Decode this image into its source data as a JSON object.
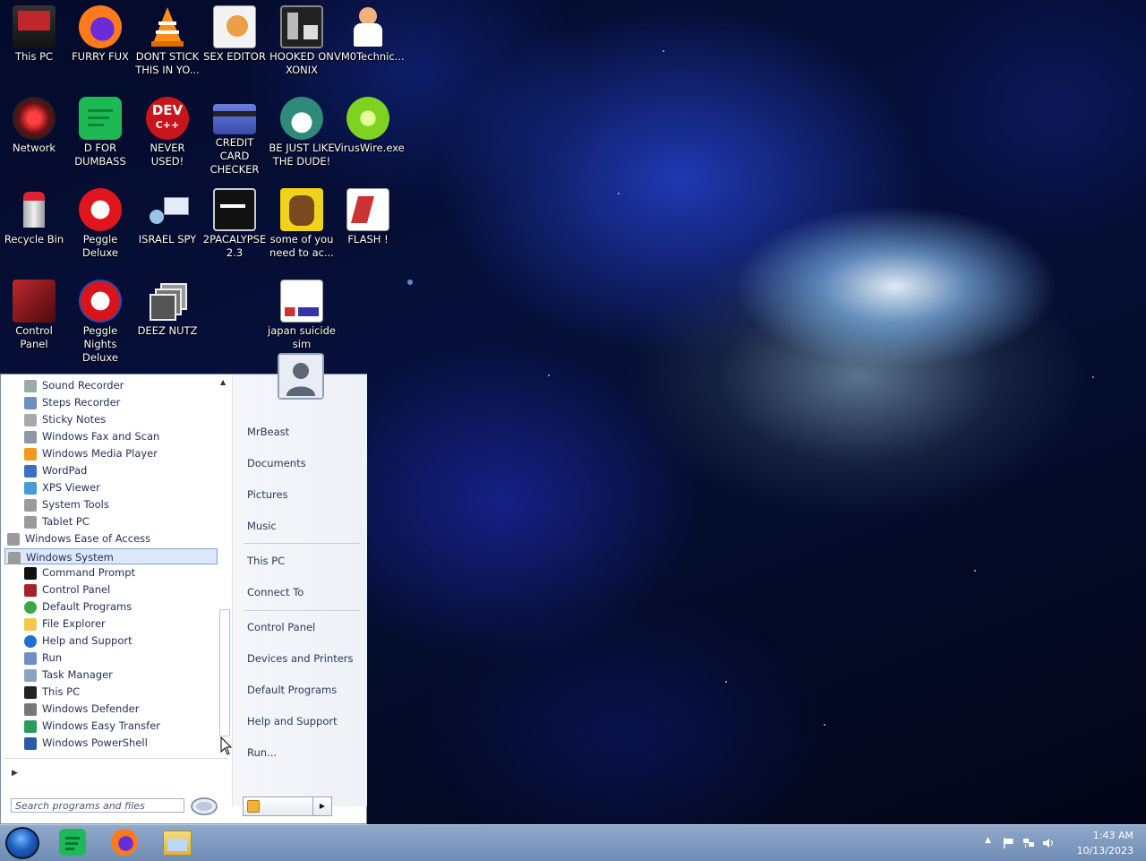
{
  "desktop": {
    "icons": [
      {
        "label": "This PC"
      },
      {
        "label": "FURRY FUX"
      },
      {
        "label": "DONT STICK THIS IN YO..."
      },
      {
        "label": "SEX EDITOR"
      },
      {
        "label": "HOOKED ON XONIX"
      },
      {
        "label": "VM0Technic..."
      },
      {
        "label": "Network"
      },
      {
        "label": "D FOR DUMBASS"
      },
      {
        "label": "NEVER USED!"
      },
      {
        "label": "CREDIT CARD CHECKER"
      },
      {
        "label": "BE JUST LIKE THE DUDE!"
      },
      {
        "label": "VirusWire.exe"
      },
      {
        "label": "Recycle Bin"
      },
      {
        "label": "Peggle Deluxe"
      },
      {
        "label": "ISRAEL SPY"
      },
      {
        "label": "2PACALYPSE 2.3"
      },
      {
        "label": "some of you need to ac..."
      },
      {
        "label": "FLASH !"
      },
      {
        "label": "Control Panel"
      },
      {
        "label": "Peggle Nights Deluxe"
      },
      {
        "label": "DEEZ NUTZ"
      },
      {
        "label": "japan suicide sim"
      }
    ],
    "dev_icon_text": "DEV",
    "dev_icon_sub": "C++"
  },
  "start_menu": {
    "programs": [
      {
        "label": "Sound Recorder",
        "icon": "microphone-icon"
      },
      {
        "label": "Steps Recorder",
        "icon": "steps-recorder-icon"
      },
      {
        "label": "Sticky Notes",
        "icon": "sticky-notes-icon"
      },
      {
        "label": "Windows Fax and Scan",
        "icon": "fax-icon"
      },
      {
        "label": "Windows Media Player",
        "icon": "media-player-icon"
      },
      {
        "label": "WordPad",
        "icon": "wordpad-icon"
      },
      {
        "label": "XPS Viewer",
        "icon": "xps-viewer-icon"
      },
      {
        "label": "System Tools",
        "icon": "folder-icon"
      },
      {
        "label": "Tablet PC",
        "icon": "folder-icon"
      },
      {
        "label": "Windows Ease of Access",
        "icon": "folder-icon"
      },
      {
        "label": "Windows System",
        "icon": "folder-icon"
      },
      {
        "label": "Command Prompt",
        "icon": "command-prompt-icon"
      },
      {
        "label": "Control Panel",
        "icon": "control-panel-icon"
      },
      {
        "label": "Default Programs",
        "icon": "default-programs-icon"
      },
      {
        "label": "File Explorer",
        "icon": "file-explorer-icon"
      },
      {
        "label": "Help and Support",
        "icon": "help-icon"
      },
      {
        "label": "Run",
        "icon": "run-icon"
      },
      {
        "label": "Task Manager",
        "icon": "task-manager-icon"
      },
      {
        "label": "This PC",
        "icon": "computer-icon"
      },
      {
        "label": "Windows Defender",
        "icon": "defender-icon"
      },
      {
        "label": "Windows Easy Transfer",
        "icon": "easy-transfer-icon"
      },
      {
        "label": "Windows PowerShell",
        "icon": "powershell-icon"
      }
    ],
    "selected_program": "Windows System",
    "search_placeholder": "Search programs and files",
    "right_items": [
      {
        "label": "MrBeast"
      },
      {
        "label": "Documents"
      },
      {
        "label": "Pictures"
      },
      {
        "label": "Music"
      },
      {
        "label": "This PC"
      },
      {
        "label": "Connect To"
      },
      {
        "label": "Control Panel"
      },
      {
        "label": "Devices and Printers"
      },
      {
        "label": "Default Programs"
      },
      {
        "label": "Help and Support"
      },
      {
        "label": "Run..."
      }
    ]
  },
  "taskbar": {
    "apps": [
      {
        "name": "spotify-icon"
      },
      {
        "name": "firefox-icon"
      },
      {
        "name": "file-explorer-icon"
      }
    ],
    "clock_time": "1:43 AM",
    "clock_date": "10/13/2023",
    "tray_icons": [
      "show-hidden-icons-icon",
      "action-center-flag-icon",
      "network-icon",
      "volume-icon"
    ]
  },
  "colors": {
    "taskbar": "#7f9cc2",
    "selection": "#dce8fb",
    "menu_text": "#1f2f55"
  }
}
